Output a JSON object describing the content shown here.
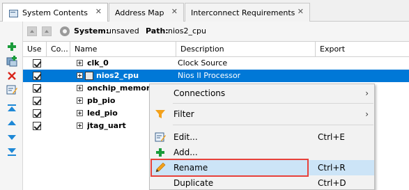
{
  "tabs": [
    {
      "label": "System Contents",
      "close": "✕"
    },
    {
      "label": "Address Map",
      "close": "✕"
    },
    {
      "label": "Interconnect Requirements",
      "close": "✕"
    }
  ],
  "pathbar": {
    "system_label": "System:",
    "system_value": "unsaved",
    "path_label": "Path:",
    "path_value": "nios2_cpu"
  },
  "table": {
    "headers": [
      "Use",
      "Co...",
      "Name",
      "Description",
      "Export"
    ],
    "rows": [
      {
        "name": "clk_0",
        "description": "Clock Source"
      },
      {
        "name": "nios2_cpu",
        "description": "Nios II Processor"
      },
      {
        "name": "onchip_memory",
        "description": ""
      },
      {
        "name": "pb_pio",
        "description": ""
      },
      {
        "name": "led_pio",
        "description": ""
      },
      {
        "name": "jtag_uart",
        "description": ""
      }
    ]
  },
  "context_menu": {
    "items": [
      {
        "label": "Connections",
        "shortcut": "",
        "arrow": "›"
      },
      {
        "label": "Filter",
        "shortcut": "",
        "arrow": "›"
      },
      {
        "label": "Edit...",
        "shortcut": "Ctrl+E",
        "arrow": ""
      },
      {
        "label": "Add...",
        "shortcut": "",
        "arrow": ""
      },
      {
        "label": "Rename",
        "shortcut": "Ctrl+R",
        "arrow": ""
      },
      {
        "label": "Duplicate",
        "shortcut": "Ctrl+D",
        "arrow": ""
      }
    ]
  },
  "colors": {
    "selection": "#0078d7",
    "menu_highlight": "#cce4f7",
    "callout_box": "#e8413b",
    "add_green": "#1a9b3a",
    "remove_red": "#d9261c",
    "move_blue": "#1e88d6",
    "filter_orange": "#f3a11b"
  }
}
